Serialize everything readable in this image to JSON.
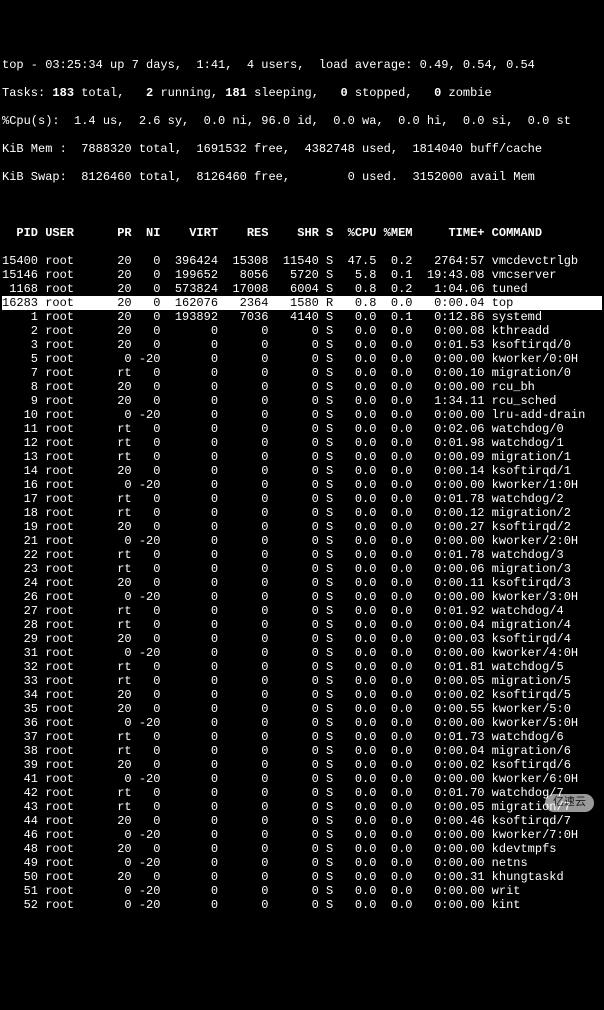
{
  "header": {
    "line1": "top - 03:25:34 up 7 days,  1:41,  4 users,  load average: 0.49, 0.54, 0.54",
    "line2_a": "Tasks: ",
    "line2_b": "183 ",
    "line2_c": "total,   ",
    "line2_d": "2 ",
    "line2_e": "running, ",
    "line2_f": "181 ",
    "line2_g": "sleeping,   ",
    "line2_h": "0 ",
    "line2_i": "stopped,   ",
    "line2_j": "0 ",
    "line2_k": "zombie",
    "line3": "%Cpu(s):  1.4 us,  2.6 sy,  0.0 ni, 96.0 id,  0.0 wa,  0.0 hi,  0.0 si,  0.0 st",
    "line4": "KiB Mem :  7888320 total,  1691532 free,  4382748 used,  1814040 buff/cache",
    "line5": "KiB Swap:  8126460 total,  8126460 free,        0 used.  3152000 avail Mem "
  },
  "cols": "  PID USER      PR  NI    VIRT    RES    SHR S  %CPU %MEM     TIME+ COMMAND     ",
  "rows": [
    {
      "hl": false,
      "pid": "15400",
      "user": "root",
      "pr": "20",
      "ni": "0",
      "virt": "396424",
      "res": "15308",
      "shr": "11540",
      "s": "S",
      "cpu": "47.5",
      "mem": "0.2",
      "time": "2764:57",
      "cmd": "vmcdevctrlgb"
    },
    {
      "hl": false,
      "pid": "15146",
      "user": "root",
      "pr": "20",
      "ni": "0",
      "virt": "199652",
      "res": "8056",
      "shr": "5720",
      "s": "S",
      "cpu": "5.8",
      "mem": "0.1",
      "time": "19:43.08",
      "cmd": "vmcserver"
    },
    {
      "hl": false,
      "pid": "1168",
      "user": "root",
      "pr": "20",
      "ni": "0",
      "virt": "573824",
      "res": "17008",
      "shr": "6004",
      "s": "S",
      "cpu": "0.8",
      "mem": "0.2",
      "time": "1:04.06",
      "cmd": "tuned"
    },
    {
      "hl": true,
      "pid": "16283",
      "user": "root",
      "pr": "20",
      "ni": "0",
      "virt": "162076",
      "res": "2364",
      "shr": "1580",
      "s": "R",
      "cpu": "0.8",
      "mem": "0.0",
      "time": "0:00.04",
      "cmd": "top"
    },
    {
      "hl": false,
      "pid": "1",
      "user": "root",
      "pr": "20",
      "ni": "0",
      "virt": "193892",
      "res": "7036",
      "shr": "4140",
      "s": "S",
      "cpu": "0.0",
      "mem": "0.1",
      "time": "0:12.86",
      "cmd": "systemd"
    },
    {
      "hl": false,
      "pid": "2",
      "user": "root",
      "pr": "20",
      "ni": "0",
      "virt": "0",
      "res": "0",
      "shr": "0",
      "s": "S",
      "cpu": "0.0",
      "mem": "0.0",
      "time": "0:00.08",
      "cmd": "kthreadd"
    },
    {
      "hl": false,
      "pid": "3",
      "user": "root",
      "pr": "20",
      "ni": "0",
      "virt": "0",
      "res": "0",
      "shr": "0",
      "s": "S",
      "cpu": "0.0",
      "mem": "0.0",
      "time": "0:01.53",
      "cmd": "ksoftirqd/0"
    },
    {
      "hl": false,
      "pid": "5",
      "user": "root",
      "pr": "0",
      "ni": "-20",
      "virt": "0",
      "res": "0",
      "shr": "0",
      "s": "S",
      "cpu": "0.0",
      "mem": "0.0",
      "time": "0:00.00",
      "cmd": "kworker/0:0H"
    },
    {
      "hl": false,
      "pid": "7",
      "user": "root",
      "pr": "rt",
      "ni": "0",
      "virt": "0",
      "res": "0",
      "shr": "0",
      "s": "S",
      "cpu": "0.0",
      "mem": "0.0",
      "time": "0:00.10",
      "cmd": "migration/0"
    },
    {
      "hl": false,
      "pid": "8",
      "user": "root",
      "pr": "20",
      "ni": "0",
      "virt": "0",
      "res": "0",
      "shr": "0",
      "s": "S",
      "cpu": "0.0",
      "mem": "0.0",
      "time": "0:00.00",
      "cmd": "rcu_bh"
    },
    {
      "hl": false,
      "pid": "9",
      "user": "root",
      "pr": "20",
      "ni": "0",
      "virt": "0",
      "res": "0",
      "shr": "0",
      "s": "S",
      "cpu": "0.0",
      "mem": "0.0",
      "time": "1:34.11",
      "cmd": "rcu_sched"
    },
    {
      "hl": false,
      "pid": "10",
      "user": "root",
      "pr": "0",
      "ni": "-20",
      "virt": "0",
      "res": "0",
      "shr": "0",
      "s": "S",
      "cpu": "0.0",
      "mem": "0.0",
      "time": "0:00.00",
      "cmd": "lru-add-drain"
    },
    {
      "hl": false,
      "pid": "11",
      "user": "root",
      "pr": "rt",
      "ni": "0",
      "virt": "0",
      "res": "0",
      "shr": "0",
      "s": "S",
      "cpu": "0.0",
      "mem": "0.0",
      "time": "0:02.06",
      "cmd": "watchdog/0"
    },
    {
      "hl": false,
      "pid": "12",
      "user": "root",
      "pr": "rt",
      "ni": "0",
      "virt": "0",
      "res": "0",
      "shr": "0",
      "s": "S",
      "cpu": "0.0",
      "mem": "0.0",
      "time": "0:01.98",
      "cmd": "watchdog/1"
    },
    {
      "hl": false,
      "pid": "13",
      "user": "root",
      "pr": "rt",
      "ni": "0",
      "virt": "0",
      "res": "0",
      "shr": "0",
      "s": "S",
      "cpu": "0.0",
      "mem": "0.0",
      "time": "0:00.09",
      "cmd": "migration/1"
    },
    {
      "hl": false,
      "pid": "14",
      "user": "root",
      "pr": "20",
      "ni": "0",
      "virt": "0",
      "res": "0",
      "shr": "0",
      "s": "S",
      "cpu": "0.0",
      "mem": "0.0",
      "time": "0:00.14",
      "cmd": "ksoftirqd/1"
    },
    {
      "hl": false,
      "pid": "16",
      "user": "root",
      "pr": "0",
      "ni": "-20",
      "virt": "0",
      "res": "0",
      "shr": "0",
      "s": "S",
      "cpu": "0.0",
      "mem": "0.0",
      "time": "0:00.00",
      "cmd": "kworker/1:0H"
    },
    {
      "hl": false,
      "pid": "17",
      "user": "root",
      "pr": "rt",
      "ni": "0",
      "virt": "0",
      "res": "0",
      "shr": "0",
      "s": "S",
      "cpu": "0.0",
      "mem": "0.0",
      "time": "0:01.78",
      "cmd": "watchdog/2"
    },
    {
      "hl": false,
      "pid": "18",
      "user": "root",
      "pr": "rt",
      "ni": "0",
      "virt": "0",
      "res": "0",
      "shr": "0",
      "s": "S",
      "cpu": "0.0",
      "mem": "0.0",
      "time": "0:00.12",
      "cmd": "migration/2"
    },
    {
      "hl": false,
      "pid": "19",
      "user": "root",
      "pr": "20",
      "ni": "0",
      "virt": "0",
      "res": "0",
      "shr": "0",
      "s": "S",
      "cpu": "0.0",
      "mem": "0.0",
      "time": "0:00.27",
      "cmd": "ksoftirqd/2"
    },
    {
      "hl": false,
      "pid": "21",
      "user": "root",
      "pr": "0",
      "ni": "-20",
      "virt": "0",
      "res": "0",
      "shr": "0",
      "s": "S",
      "cpu": "0.0",
      "mem": "0.0",
      "time": "0:00.00",
      "cmd": "kworker/2:0H"
    },
    {
      "hl": false,
      "pid": "22",
      "user": "root",
      "pr": "rt",
      "ni": "0",
      "virt": "0",
      "res": "0",
      "shr": "0",
      "s": "S",
      "cpu": "0.0",
      "mem": "0.0",
      "time": "0:01.78",
      "cmd": "watchdog/3"
    },
    {
      "hl": false,
      "pid": "23",
      "user": "root",
      "pr": "rt",
      "ni": "0",
      "virt": "0",
      "res": "0",
      "shr": "0",
      "s": "S",
      "cpu": "0.0",
      "mem": "0.0",
      "time": "0:00.06",
      "cmd": "migration/3"
    },
    {
      "hl": false,
      "pid": "24",
      "user": "root",
      "pr": "20",
      "ni": "0",
      "virt": "0",
      "res": "0",
      "shr": "0",
      "s": "S",
      "cpu": "0.0",
      "mem": "0.0",
      "time": "0:00.11",
      "cmd": "ksoftirqd/3"
    },
    {
      "hl": false,
      "pid": "26",
      "user": "root",
      "pr": "0",
      "ni": "-20",
      "virt": "0",
      "res": "0",
      "shr": "0",
      "s": "S",
      "cpu": "0.0",
      "mem": "0.0",
      "time": "0:00.00",
      "cmd": "kworker/3:0H"
    },
    {
      "hl": false,
      "pid": "27",
      "user": "root",
      "pr": "rt",
      "ni": "0",
      "virt": "0",
      "res": "0",
      "shr": "0",
      "s": "S",
      "cpu": "0.0",
      "mem": "0.0",
      "time": "0:01.92",
      "cmd": "watchdog/4"
    },
    {
      "hl": false,
      "pid": "28",
      "user": "root",
      "pr": "rt",
      "ni": "0",
      "virt": "0",
      "res": "0",
      "shr": "0",
      "s": "S",
      "cpu": "0.0",
      "mem": "0.0",
      "time": "0:00.04",
      "cmd": "migration/4"
    },
    {
      "hl": false,
      "pid": "29",
      "user": "root",
      "pr": "20",
      "ni": "0",
      "virt": "0",
      "res": "0",
      "shr": "0",
      "s": "S",
      "cpu": "0.0",
      "mem": "0.0",
      "time": "0:00.03",
      "cmd": "ksoftirqd/4"
    },
    {
      "hl": false,
      "pid": "31",
      "user": "root",
      "pr": "0",
      "ni": "-20",
      "virt": "0",
      "res": "0",
      "shr": "0",
      "s": "S",
      "cpu": "0.0",
      "mem": "0.0",
      "time": "0:00.00",
      "cmd": "kworker/4:0H"
    },
    {
      "hl": false,
      "pid": "32",
      "user": "root",
      "pr": "rt",
      "ni": "0",
      "virt": "0",
      "res": "0",
      "shr": "0",
      "s": "S",
      "cpu": "0.0",
      "mem": "0.0",
      "time": "0:01.81",
      "cmd": "watchdog/5"
    },
    {
      "hl": false,
      "pid": "33",
      "user": "root",
      "pr": "rt",
      "ni": "0",
      "virt": "0",
      "res": "0",
      "shr": "0",
      "s": "S",
      "cpu": "0.0",
      "mem": "0.0",
      "time": "0:00.05",
      "cmd": "migration/5"
    },
    {
      "hl": false,
      "pid": "34",
      "user": "root",
      "pr": "20",
      "ni": "0",
      "virt": "0",
      "res": "0",
      "shr": "0",
      "s": "S",
      "cpu": "0.0",
      "mem": "0.0",
      "time": "0:00.02",
      "cmd": "ksoftirqd/5"
    },
    {
      "hl": false,
      "pid": "35",
      "user": "root",
      "pr": "20",
      "ni": "0",
      "virt": "0",
      "res": "0",
      "shr": "0",
      "s": "S",
      "cpu": "0.0",
      "mem": "0.0",
      "time": "0:00.55",
      "cmd": "kworker/5:0"
    },
    {
      "hl": false,
      "pid": "36",
      "user": "root",
      "pr": "0",
      "ni": "-20",
      "virt": "0",
      "res": "0",
      "shr": "0",
      "s": "S",
      "cpu": "0.0",
      "mem": "0.0",
      "time": "0:00.00",
      "cmd": "kworker/5:0H"
    },
    {
      "hl": false,
      "pid": "37",
      "user": "root",
      "pr": "rt",
      "ni": "0",
      "virt": "0",
      "res": "0",
      "shr": "0",
      "s": "S",
      "cpu": "0.0",
      "mem": "0.0",
      "time": "0:01.73",
      "cmd": "watchdog/6"
    },
    {
      "hl": false,
      "pid": "38",
      "user": "root",
      "pr": "rt",
      "ni": "0",
      "virt": "0",
      "res": "0",
      "shr": "0",
      "s": "S",
      "cpu": "0.0",
      "mem": "0.0",
      "time": "0:00.04",
      "cmd": "migration/6"
    },
    {
      "hl": false,
      "pid": "39",
      "user": "root",
      "pr": "20",
      "ni": "0",
      "virt": "0",
      "res": "0",
      "shr": "0",
      "s": "S",
      "cpu": "0.0",
      "mem": "0.0",
      "time": "0:00.02",
      "cmd": "ksoftirqd/6"
    },
    {
      "hl": false,
      "pid": "41",
      "user": "root",
      "pr": "0",
      "ni": "-20",
      "virt": "0",
      "res": "0",
      "shr": "0",
      "s": "S",
      "cpu": "0.0",
      "mem": "0.0",
      "time": "0:00.00",
      "cmd": "kworker/6:0H"
    },
    {
      "hl": false,
      "pid": "42",
      "user": "root",
      "pr": "rt",
      "ni": "0",
      "virt": "0",
      "res": "0",
      "shr": "0",
      "s": "S",
      "cpu": "0.0",
      "mem": "0.0",
      "time": "0:01.70",
      "cmd": "watchdog/7"
    },
    {
      "hl": false,
      "pid": "43",
      "user": "root",
      "pr": "rt",
      "ni": "0",
      "virt": "0",
      "res": "0",
      "shr": "0",
      "s": "S",
      "cpu": "0.0",
      "mem": "0.0",
      "time": "0:00.05",
      "cmd": "migration/7"
    },
    {
      "hl": false,
      "pid": "44",
      "user": "root",
      "pr": "20",
      "ni": "0",
      "virt": "0",
      "res": "0",
      "shr": "0",
      "s": "S",
      "cpu": "0.0",
      "mem": "0.0",
      "time": "0:00.46",
      "cmd": "ksoftirqd/7"
    },
    {
      "hl": false,
      "pid": "46",
      "user": "root",
      "pr": "0",
      "ni": "-20",
      "virt": "0",
      "res": "0",
      "shr": "0",
      "s": "S",
      "cpu": "0.0",
      "mem": "0.0",
      "time": "0:00.00",
      "cmd": "kworker/7:0H"
    },
    {
      "hl": false,
      "pid": "48",
      "user": "root",
      "pr": "20",
      "ni": "0",
      "virt": "0",
      "res": "0",
      "shr": "0",
      "s": "S",
      "cpu": "0.0",
      "mem": "0.0",
      "time": "0:00.00",
      "cmd": "kdevtmpfs"
    },
    {
      "hl": false,
      "pid": "49",
      "user": "root",
      "pr": "0",
      "ni": "-20",
      "virt": "0",
      "res": "0",
      "shr": "0",
      "s": "S",
      "cpu": "0.0",
      "mem": "0.0",
      "time": "0:00.00",
      "cmd": "netns"
    },
    {
      "hl": false,
      "pid": "50",
      "user": "root",
      "pr": "20",
      "ni": "0",
      "virt": "0",
      "res": "0",
      "shr": "0",
      "s": "S",
      "cpu": "0.0",
      "mem": "0.0",
      "time": "0:00.31",
      "cmd": "khungtaskd"
    },
    {
      "hl": false,
      "pid": "51",
      "user": "root",
      "pr": "0",
      "ni": "-20",
      "virt": "0",
      "res": "0",
      "shr": "0",
      "s": "S",
      "cpu": "0.0",
      "mem": "0.0",
      "time": "0:00.00",
      "cmd": "writ"
    },
    {
      "hl": false,
      "pid": "52",
      "user": "root",
      "pr": "0",
      "ni": "-20",
      "virt": "0",
      "res": "0",
      "shr": "0",
      "s": "S",
      "cpu": "0.0",
      "mem": "0.0",
      "time": "0:00.00",
      "cmd": "kint"
    }
  ],
  "watermark": "亿速云"
}
